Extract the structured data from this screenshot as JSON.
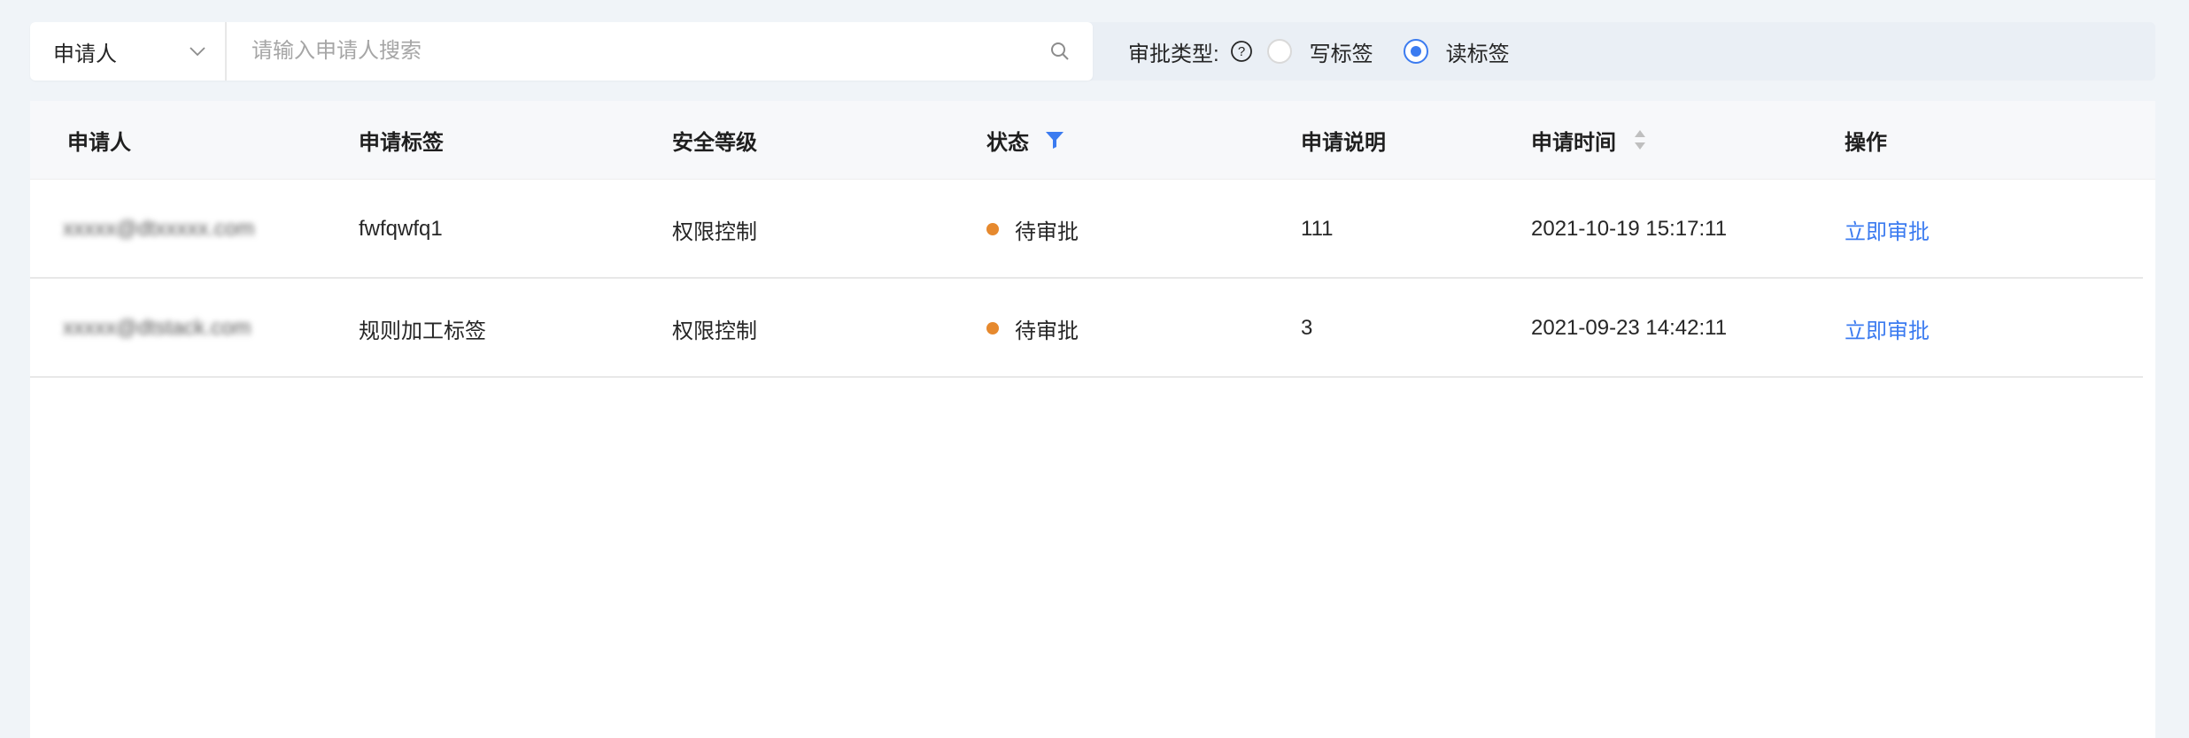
{
  "search": {
    "field_select": "申请人",
    "placeholder": "请输入申请人搜索"
  },
  "filter": {
    "label": "审批类型:",
    "options": [
      {
        "label": "写标签",
        "checked": false
      },
      {
        "label": "读标签",
        "checked": true
      }
    ]
  },
  "table": {
    "headers": {
      "applicant": "申请人",
      "tag": "申请标签",
      "level": "安全等级",
      "status": "状态",
      "description": "申请说明",
      "time": "申请时间",
      "action": "操作"
    },
    "rows": [
      {
        "applicant": "xxxxx@dtxxxxx.com",
        "tag": "fwfqwfq1",
        "level": "权限控制",
        "status": "待审批",
        "description": "111",
        "time": "2021-10-19 15:17:11",
        "action": "立即审批"
      },
      {
        "applicant": "xxxxx@dtstack.com",
        "tag": "规则加工标签",
        "level": "权限控制",
        "status": "待审批",
        "description": "3",
        "time": "2021-09-23 14:42:11",
        "action": "立即审批"
      }
    ]
  },
  "colors": {
    "accent": "#3b7bf0",
    "status_pending": "#e6892e"
  }
}
